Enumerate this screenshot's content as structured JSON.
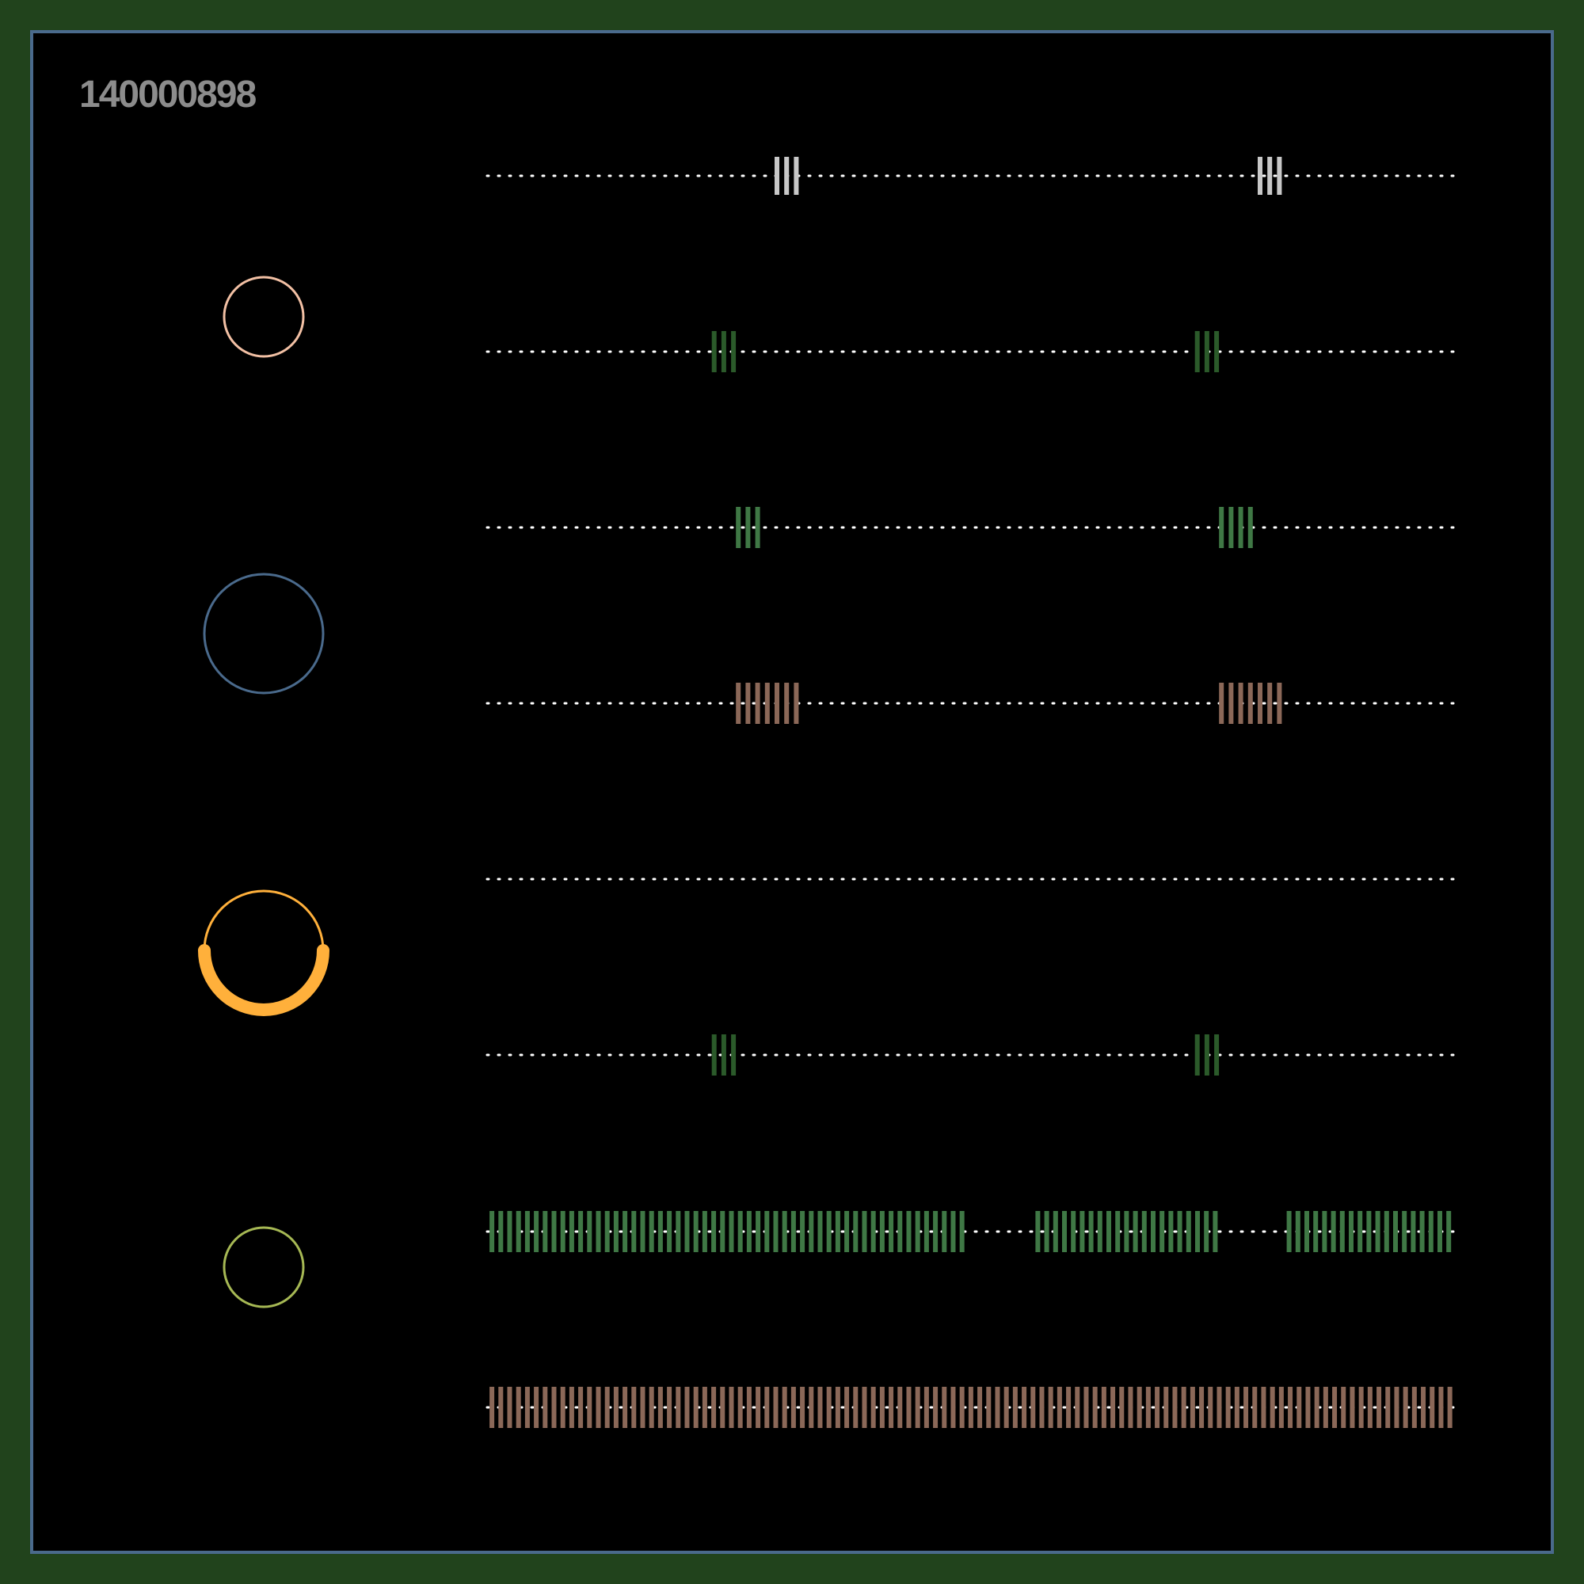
{
  "id_label": "140000898",
  "colors": {
    "frame": "#21431c",
    "panel": "#000000",
    "panel_border": "#4a6a8c",
    "id_text": "#8c8c8c",
    "dots": "#ffffff"
  },
  "circles": [
    {
      "name": "peach-ring",
      "color": "#f2c0a4",
      "style": "thin"
    },
    {
      "name": "blue-ring",
      "color": "#4a6a8c",
      "style": "thin"
    },
    {
      "name": "orange-ring",
      "color": "#ffb03b",
      "style": "thick-lower-half"
    },
    {
      "name": "olive-ring",
      "color": "#a6b854",
      "style": "thin"
    }
  ],
  "tracks": [
    {
      "color": "#c8c8c8",
      "tall": true,
      "runs": [
        [
          0.3,
          0.32
        ],
        [
          0.8,
          0.82
        ]
      ],
      "step": 0.01
    },
    {
      "color": "#2b5a2a",
      "tall": false,
      "runs": [
        [
          0.235,
          0.255
        ],
        [
          0.735,
          0.755
        ]
      ],
      "step": 0.01
    },
    {
      "color": "#3f7845",
      "tall": false,
      "runs": [
        [
          0.26,
          0.28
        ],
        [
          0.76,
          0.795
        ]
      ],
      "step": 0.01
    },
    {
      "color": "#8b6858",
      "tall": false,
      "runs": [
        [
          0.26,
          0.32
        ],
        [
          0.76,
          0.82
        ]
      ],
      "step": 0.01
    },
    {
      "color": "#ffffff",
      "tall": false,
      "runs": [],
      "step": 0.01
    },
    {
      "color": "#2b5a2a",
      "tall": false,
      "runs": [
        [
          0.235,
          0.255
        ],
        [
          0.735,
          0.755
        ]
      ],
      "step": 0.01
    },
    {
      "color": "#3f7845",
      "tall": false,
      "runs": [
        [
          0.005,
          0.5
        ],
        [
          0.57,
          0.755
        ],
        [
          0.83,
          1.0
        ]
      ],
      "step": 0.00918
    },
    {
      "color": "#8b6858",
      "tall": false,
      "runs": [
        [
          0.005,
          1.0
        ]
      ],
      "step": 0.00918
    }
  ]
}
